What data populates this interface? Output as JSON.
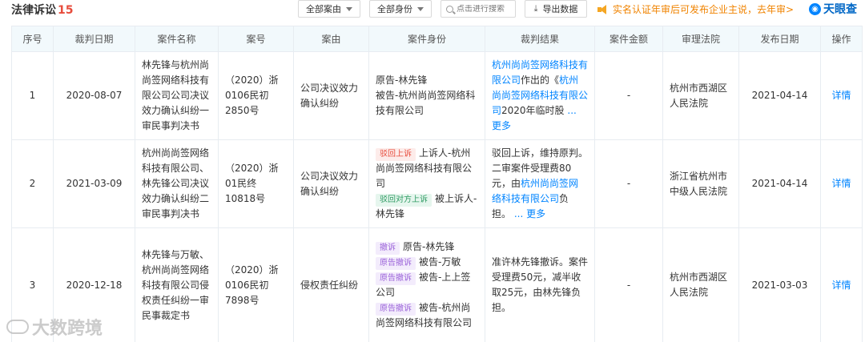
{
  "header": {
    "title": "法律诉讼",
    "count": "15",
    "filter_reason": "全部案由",
    "filter_identity": "全部身份",
    "search_placeholder": "点击进行搜索",
    "export_label": "导出数据",
    "notice": "实名认证年审后可发布企业主说，去年审>",
    "brand": "天眼查"
  },
  "columns": [
    "序号",
    "裁判日期",
    "案件名称",
    "案号",
    "案由",
    "案件身份",
    "裁判结果",
    "案件金额",
    "审理法院",
    "发布日期",
    "操作"
  ],
  "rows": [
    {
      "index": "1",
      "judgment_date": "2020-08-07",
      "case_name": "林先锋与杭州尚尚签网络科技有限公司公司决议效力确认纠纷一审民事判决书",
      "case_no": "（2020）浙0106民初2850号",
      "reason": "公司决议效力确认纠纷",
      "identity_line1": "原告-林先锋",
      "identity_line2": "被告-杭州尚尚签网络科技有限公司",
      "result_link": "杭州尚尚签网络科技有限公司",
      "result_text1": "作出的《",
      "result_link2": "杭州尚尚签网络科技有限公司",
      "result_text2": "2020年临时股",
      "more": "... 更多",
      "amount": "-",
      "court": "杭州市西湖区人民法院",
      "publish_date": "2021-04-14",
      "action": "详情"
    },
    {
      "index": "2",
      "judgment_date": "2021-03-09",
      "case_name": "杭州尚尚签网络科技有限公司、林先锋公司决议效力确认纠纷二审民事判决书",
      "case_no": "（2020）浙01民终10818号",
      "reason": "公司决议效力确认纠纷",
      "tag1": "驳回上诉",
      "identity_line1": "上诉人-杭州尚尚签网络科技有限公司",
      "tag2": "驳回对方上诉",
      "identity_line2": "被上诉人-林先锋",
      "result_text1": "驳回上诉，维持原判。二审案件受理费80元，由",
      "result_link": "杭州尚尚签网络科技有限公司",
      "result_text2": "负担。",
      "more": "... 更多",
      "amount": "-",
      "court": "浙江省杭州市中级人民法院",
      "publish_date": "2021-04-14",
      "action": "详情"
    },
    {
      "index": "3",
      "judgment_date": "2020-12-18",
      "case_name": "林先锋与万敏、杭州尚尚签网络科技有限公司侵权责任纠纷一审民事裁定书",
      "case_no": "（2020）浙0106民初7898号",
      "reason": "侵权责任纠纷",
      "tag1": "撤诉",
      "identity_line1": "原告-林先锋",
      "tag2": "原告撤诉",
      "identity_line2": "被告-万敏",
      "tag3": "原告撤诉",
      "identity_line3": "被告-上上签公司",
      "tag4": "原告撤诉",
      "identity_line4": "被告-杭州尚尚签网络科技有限公司",
      "result_text1": "准许林先锋撤诉。案件受理费50元，减半收取25元，由林先锋负担。",
      "amount": "-",
      "court": "杭州市西湖区人民法院",
      "publish_date": "2021-03-03",
      "action": "详情"
    }
  ],
  "watermark": "大数跨境"
}
